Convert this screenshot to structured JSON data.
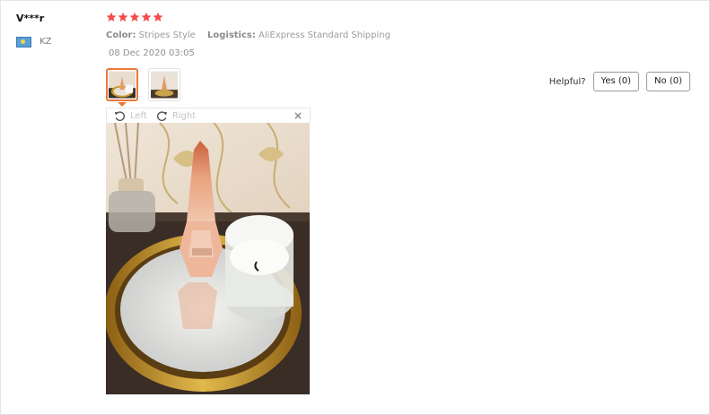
{
  "review": {
    "user": "V***r",
    "country_code": "KZ",
    "rating": 5,
    "color_label": "Color:",
    "color_value": "Stripes Style",
    "logistics_label": "Logistics:",
    "logistics_value": "AliExpress Standard Shipping",
    "date": "08 Dec 2020 03:05",
    "photos": [
      {
        "name": "perfume-photo-1",
        "selected": true
      },
      {
        "name": "perfume-photo-2",
        "selected": false
      }
    ]
  },
  "helpful": {
    "label": "Helpful?",
    "yes": "Yes (0)",
    "no": "No (0)"
  },
  "viewer": {
    "rotate_left": "Left",
    "rotate_right": "Right",
    "close": "×"
  },
  "icons": {
    "star": "star-icon",
    "flag": "flag-icon",
    "rotate_left": "rotate-left-icon",
    "rotate_right": "rotate-right-icon",
    "close": "close-icon"
  },
  "colors": {
    "star": "#f44b4b",
    "thumb_active_border": "#e8793c"
  }
}
